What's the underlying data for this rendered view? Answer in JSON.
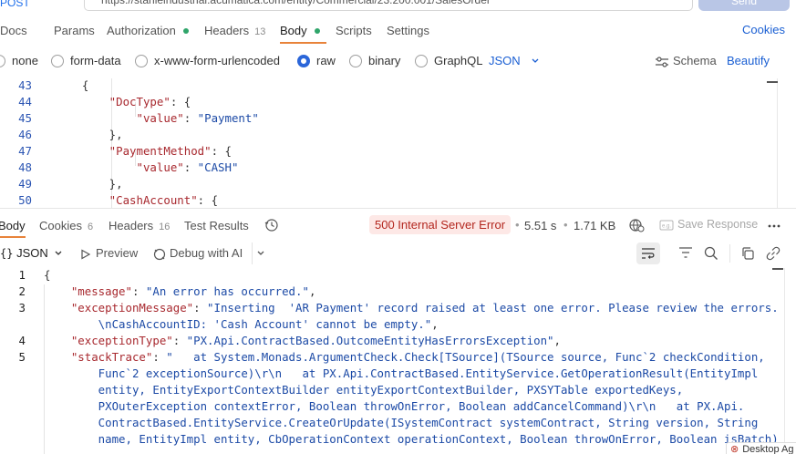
{
  "request": {
    "method": "POST",
    "url": "https://stanleindustrial.acumatica.com/entity/Commercial/23.200.001/SalesOrder",
    "send_label": "Send",
    "tabs": [
      {
        "label": "Docs"
      },
      {
        "label": "Params"
      },
      {
        "label": "Authorization"
      },
      {
        "label": "Headers",
        "count": "13"
      },
      {
        "label": "Body"
      },
      {
        "label": "Scripts"
      },
      {
        "label": "Settings"
      }
    ],
    "cookies_label": "Cookies",
    "body_types": [
      "none",
      "form-data",
      "x-www-form-urlencoded",
      "raw",
      "binary",
      "GraphQL"
    ],
    "selected_body_type": "raw",
    "format": "JSON",
    "schema_label": "Schema",
    "beautify_label": "Beautify",
    "lines": [
      {
        "n": "43",
        "segments": [
          {
            "t": "    {",
            "c": "punc"
          }
        ]
      },
      {
        "n": "44",
        "segments": [
          {
            "t": "        \"DocType\"",
            "c": "key"
          },
          {
            "t": ": {",
            "c": "punc"
          }
        ]
      },
      {
        "n": "45",
        "segments": [
          {
            "t": "            \"value\"",
            "c": "key"
          },
          {
            "t": ": ",
            "c": "punc"
          },
          {
            "t": "\"Payment\"",
            "c": "str"
          }
        ]
      },
      {
        "n": "46",
        "segments": [
          {
            "t": "        },",
            "c": "punc"
          }
        ]
      },
      {
        "n": "47",
        "segments": [
          {
            "t": "        \"PaymentMethod\"",
            "c": "key"
          },
          {
            "t": ": {",
            "c": "punc"
          }
        ]
      },
      {
        "n": "48",
        "segments": [
          {
            "t": "            \"value\"",
            "c": "key"
          },
          {
            "t": ": ",
            "c": "punc"
          },
          {
            "t": "\"CASH\"",
            "c": "str"
          }
        ]
      },
      {
        "n": "49",
        "segments": [
          {
            "t": "        },",
            "c": "punc"
          }
        ]
      },
      {
        "n": "50",
        "segments": [
          {
            "t": "        \"CashAccount\"",
            "c": "key"
          },
          {
            "t": ": {",
            "c": "punc"
          }
        ]
      }
    ]
  },
  "response": {
    "tabs": [
      {
        "label": "Body"
      },
      {
        "label": "Cookies",
        "count": "6"
      },
      {
        "label": "Headers",
        "count": "16"
      },
      {
        "label": "Test Results"
      }
    ],
    "status": "500 Internal Server Error",
    "time": "5.51 s",
    "size": "1.71 KB",
    "save_label": "Save Response",
    "format": "JSON",
    "preview_label": "Preview",
    "debug_label": "Debug with AI",
    "lines": [
      {
        "n": "1",
        "segments": [
          {
            "t": "{",
            "c": "punc"
          }
        ]
      },
      {
        "n": "2",
        "segments": [
          {
            "t": "    \"message\"",
            "c": "key"
          },
          {
            "t": ": ",
            "c": "punc"
          },
          {
            "t": "\"An error has occurred.\"",
            "c": "str2"
          },
          {
            "t": ",",
            "c": "punc"
          }
        ]
      },
      {
        "n": "3",
        "segments": [
          {
            "t": "    \"exceptionMessage\"",
            "c": "key"
          },
          {
            "t": ": ",
            "c": "punc"
          },
          {
            "t": "\"Inserting  'AR Payment' record raised at least one error. Please review the errors.",
            "c": "str2"
          }
        ]
      },
      {
        "n": "",
        "segments": [
          {
            "t": "        \\nCashAccountID: 'Cash Account' cannot be empty.\"",
            "c": "str2"
          },
          {
            "t": ",",
            "c": "punc"
          }
        ]
      },
      {
        "n": "4",
        "segments": [
          {
            "t": "    \"exceptionType\"",
            "c": "key"
          },
          {
            "t": ": ",
            "c": "punc"
          },
          {
            "t": "\"PX.Api.ContractBased.OutcomeEntityHasErrorsException\"",
            "c": "str2"
          },
          {
            "t": ",",
            "c": "punc"
          }
        ]
      },
      {
        "n": "5",
        "segments": [
          {
            "t": "    \"stackTrace\"",
            "c": "key"
          },
          {
            "t": ": ",
            "c": "punc"
          },
          {
            "t": "\"   at System.Monads.ArgumentCheck.Check[TSource](TSource source, Func`2 checkCondition,",
            "c": "str2"
          }
        ]
      },
      {
        "n": "",
        "segments": [
          {
            "t": "        Func`2 exceptionSource)\\r\\n   at PX.Api.ContractBased.EntityService.GetOperationResult(EntityImpl",
            "c": "str2"
          }
        ]
      },
      {
        "n": "",
        "segments": [
          {
            "t": "        entity, EntityExportContextBuilder entityExportContextBuilder, PXSYTable exportedKeys,",
            "c": "str2"
          }
        ]
      },
      {
        "n": "",
        "segments": [
          {
            "t": "        PXOuterException contextError, Boolean throwOnError, Boolean addCancelCommand)\\r\\n   at PX.Api.",
            "c": "str2"
          }
        ]
      },
      {
        "n": "",
        "segments": [
          {
            "t": "        ContractBased.EntityService.CreateOrUpdate(ISystemContract systemContract, String version, String",
            "c": "str2"
          }
        ]
      },
      {
        "n": "",
        "segments": [
          {
            "t": "        name, EntityImpl entity, CbOperationContext operationContext, Boolean throwOnError, Boolean isBatch)",
            "c": "str2"
          }
        ]
      }
    ]
  },
  "desktop_tag": "Desktop Ag"
}
